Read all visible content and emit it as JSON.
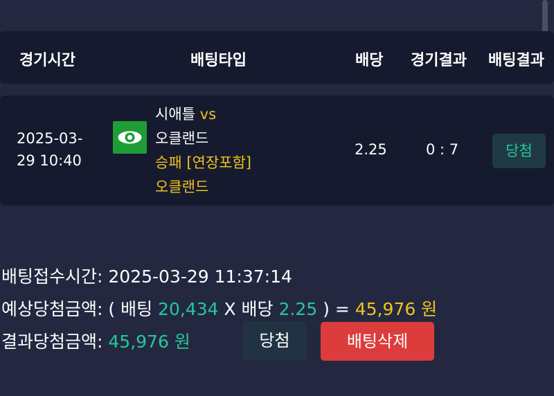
{
  "header": {
    "col_time": "경기시간",
    "col_bet_type": "배팅타입",
    "col_odds": "배당",
    "col_match_result": "경기결과",
    "col_bet_result": "배팅결과"
  },
  "bet_row": {
    "time_line1": "2025-03-",
    "time_line2": "29 10:40",
    "team_logo_icon": "eye-icon",
    "home_team": "시애틀",
    "vs": "vs",
    "away_team": "오클랜드",
    "market": "승패 [연장포함]",
    "pick": "오클랜드",
    "odds": "2.25",
    "score": "0 : 7",
    "result": "당첨"
  },
  "summary": {
    "receipt_label": "배팅접수시간:",
    "receipt_time": "2025-03-29 11:37:14",
    "expected_label": "예상당첨금액:",
    "open_paren": "( 배팅",
    "stake": "20,434",
    "times_odds": "X 배당",
    "odds": "2.25",
    "close_eq": ") =",
    "expected_amount": "45,976 원",
    "result_label": "결과당첨금액:",
    "result_amount": "45,976 원"
  },
  "actions": {
    "win_label": "당첨",
    "delete_label": "배팅삭제"
  },
  "colors": {
    "background": "#232840",
    "card": "#161a2e",
    "green": "#27c79b",
    "yellow": "#f2c31c",
    "delete_red": "#dd3c3c"
  }
}
